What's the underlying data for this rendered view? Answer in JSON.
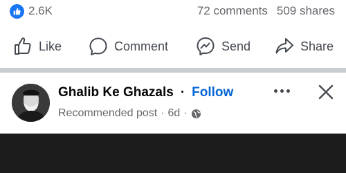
{
  "stats": {
    "likes": "2.6K",
    "comments": "72 comments",
    "shares": "509 shares",
    "like_icon": "thumbs-up-badge",
    "like_color": "#1877f2"
  },
  "actions": {
    "like": {
      "label": "Like",
      "icon": "thumbs-up-icon"
    },
    "comment": {
      "label": "Comment",
      "icon": "comment-bubble-icon"
    },
    "send": {
      "label": "Send",
      "icon": "messenger-icon"
    },
    "share": {
      "label": "Share",
      "icon": "share-arrow-icon"
    }
  },
  "post": {
    "page_name": "Ghalib Ke Ghazals",
    "separator": "·",
    "follow_label": "Follow",
    "follow_color": "#0866d4",
    "meta_type": "Recommended post",
    "meta_sep": "·",
    "meta_time": "6d",
    "audience_icon": "globe-icon"
  },
  "colors": {
    "text_primary": "#050505",
    "text_secondary": "#65676b",
    "divider": "#c9ccd1"
  }
}
